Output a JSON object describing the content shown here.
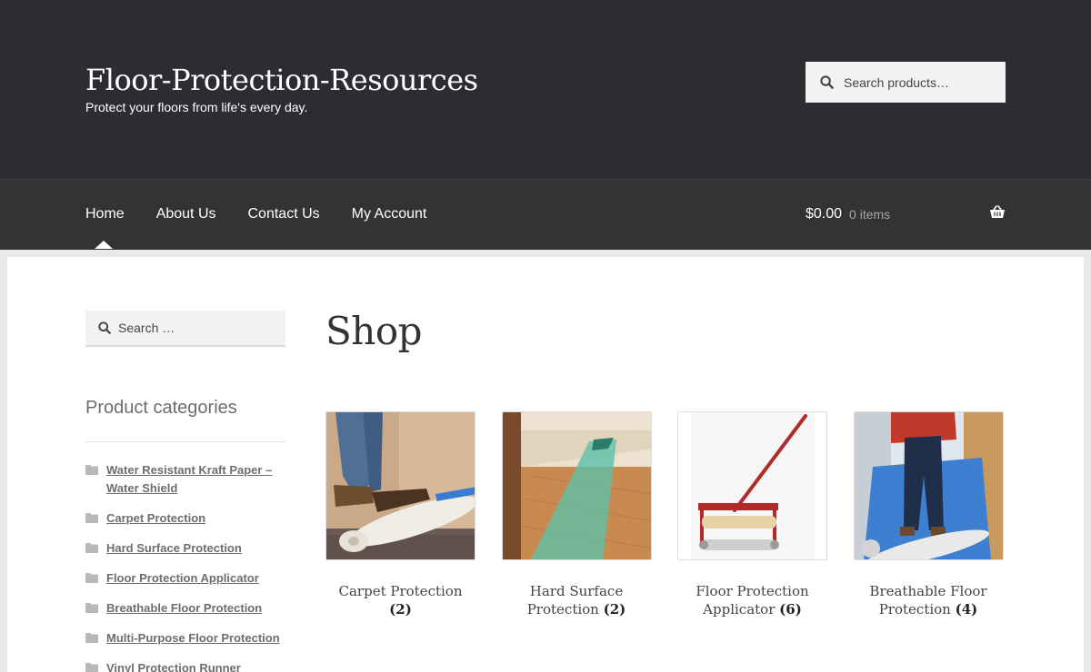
{
  "header": {
    "site_title": "Floor-Protection-Resources",
    "tagline": "Protect your floors from life's every day.",
    "search_placeholder": "Search products…",
    "background_color": "#2c2d33"
  },
  "nav": {
    "items": [
      {
        "label": "Home",
        "current": true
      },
      {
        "label": "About Us"
      },
      {
        "label": "Contact Us"
      },
      {
        "label": "My Account"
      }
    ],
    "cart": {
      "amount": "$0.00",
      "count": "0 items",
      "icon": "basket-icon"
    }
  },
  "sidebar": {
    "search_placeholder": "Search …",
    "categories_title": "Product categories",
    "categories": [
      {
        "label": "Water Resistant Kraft Paper – Water Shield"
      },
      {
        "label": "Carpet Protection"
      },
      {
        "label": "Hard Surface Protection"
      },
      {
        "label": "Floor Protection Applicator"
      },
      {
        "label": "Breathable Floor Protection"
      },
      {
        "label": "Multi-Purpose Floor Protection"
      },
      {
        "label": "Vinyl Protection Runner"
      }
    ]
  },
  "main": {
    "page_title": "Shop",
    "products": [
      {
        "name": "Carpet Protection",
        "count": "(2)"
      },
      {
        "name": "Hard Surface Protection",
        "count": "(2)"
      },
      {
        "name": "Floor Protection Applicator",
        "count": "(6)"
      },
      {
        "name": "Breathable Floor Protection",
        "count": "(4)"
      }
    ]
  }
}
